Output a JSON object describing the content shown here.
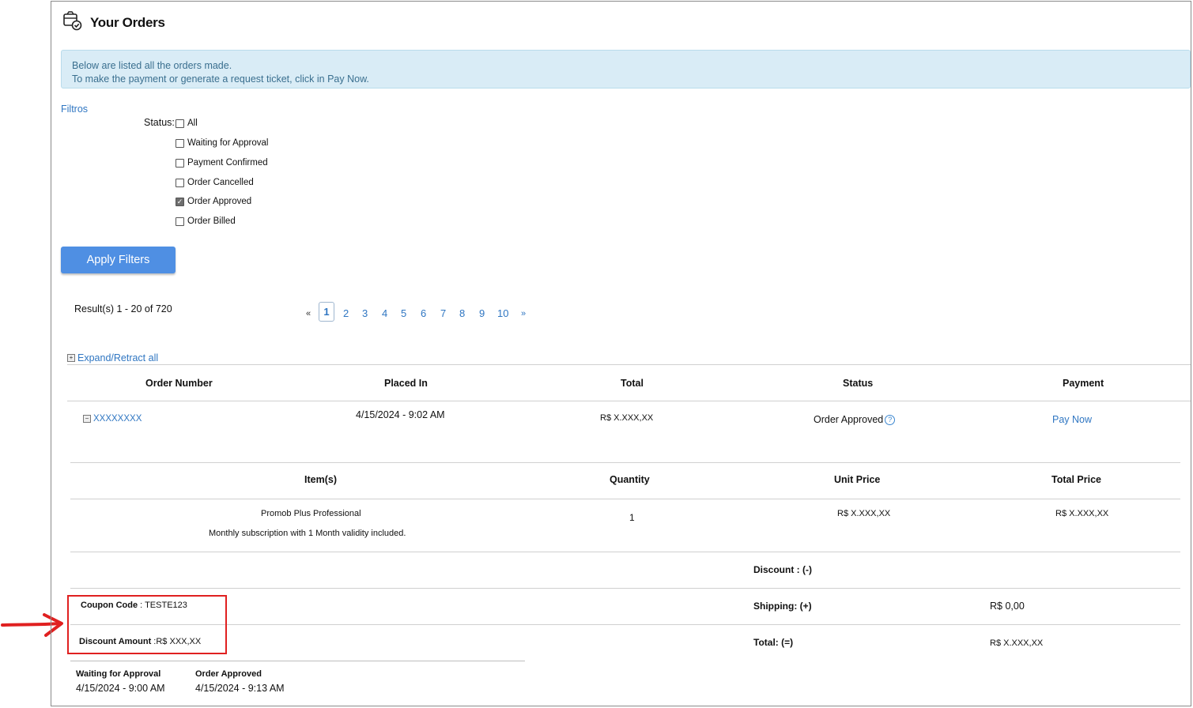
{
  "header": {
    "title": "Your Orders",
    "icon": "orders-box-check-icon"
  },
  "info": {
    "line1": "Below are listed all the orders made.",
    "line2": "To make the payment or generate a request ticket, click in Pay Now."
  },
  "filters": {
    "title": "Filtros",
    "status_label": "Status:",
    "options": [
      {
        "label": "All",
        "checked": false
      },
      {
        "label": "Waiting for Approval",
        "checked": false
      },
      {
        "label": "Payment Confirmed",
        "checked": false
      },
      {
        "label": "Order Cancelled",
        "checked": false
      },
      {
        "label": "Order Approved",
        "checked": true
      },
      {
        "label": "Order Billed",
        "checked": false
      }
    ],
    "apply_label": "Apply Filters"
  },
  "results": {
    "text": "Result(s) 1 - 20 of 720"
  },
  "pagination": {
    "prev": "«",
    "next": "»",
    "pages": [
      "1",
      "2",
      "3",
      "4",
      "5",
      "6",
      "7",
      "8",
      "9",
      "10"
    ],
    "current": "1"
  },
  "expand": {
    "label": "Expand/Retract all"
  },
  "orders_table": {
    "headers": [
      "Order Number",
      "Placed In",
      "Total",
      "Status",
      "Payment"
    ],
    "row": {
      "order_number": "XXXXXXXX",
      "placed_in": "4/15/2024 - 9:02 AM",
      "total": "R$ X.XXX,XX",
      "status": "Order Approved",
      "payment": "Pay Now"
    }
  },
  "items_table": {
    "headers": [
      "Item(s)",
      "Quantity",
      "Unit Price",
      "Total Price"
    ],
    "item": {
      "name": "Promob Plus Professional",
      "description": "Monthly subscription with 1 Month validity included.",
      "quantity": "1",
      "unit_price": "R$ X.XXX,XX",
      "total_price": "R$ X.XXX,XX"
    }
  },
  "summary": {
    "discount_label": "Discount : (-)",
    "shipping_label": "Shipping: (+)",
    "shipping_value": "R$ 0,00",
    "total_label": "Total: (=)",
    "total_value": "R$ X.XXX,XX"
  },
  "coupon": {
    "code_label": "Coupon Code",
    "code_value": " : TESTE123",
    "amount_label": "Discount Amount",
    "amount_value": " :R$ XXX,XX"
  },
  "history": [
    {
      "label": "Waiting for Approval",
      "date": "4/15/2024 - 9:00 AM"
    },
    {
      "label": "Order Approved",
      "date": "4/15/2024 - 9:13 AM"
    }
  ],
  "annotation_color": "#e02020"
}
